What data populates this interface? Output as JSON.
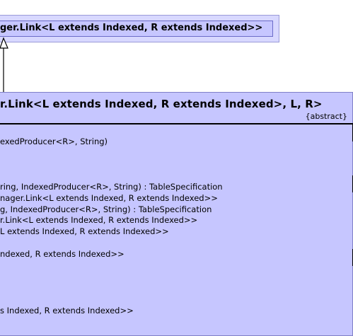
{
  "parent_class": {
    "title": "ger.Link<L extends Indexed, R extends Indexed>>"
  },
  "main_class": {
    "title": "r.Link<L extends Indexed, R extends Indexed>, L, R>",
    "stereotype": "{abstract}"
  },
  "members": [
    {
      "text": "exedProducer<R>, String)"
    },
    {
      "text": "ring, IndexedProducer<R>, String) : TableSpecification"
    },
    {
      "text": "nager.Link<L extends Indexed, R extends Indexed>>"
    },
    {
      "text": "g, IndexedProducer<R>, String) : TableSpecification"
    },
    {
      "text": "r.Link<L extends Indexed, R extends Indexed>>"
    },
    {
      "text": "L extends Indexed, R extends Indexed>>"
    },
    {
      "text": "ndexed, R extends Indexed>>"
    },
    {
      "text": "s Indexed, R extends Indexed>>"
    }
  ],
  "colors": {
    "class_fill": "#c6c6ff",
    "parent_outer_fill": "#d8d8ff",
    "line": "#000000"
  }
}
